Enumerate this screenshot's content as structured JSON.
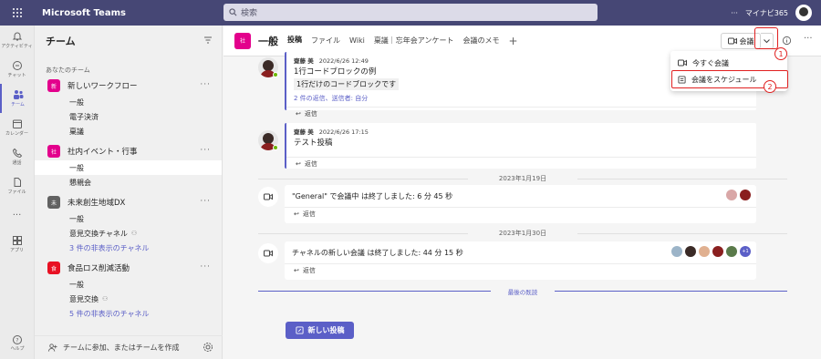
{
  "topbar": {
    "app_title": "Microsoft Teams",
    "search_placeholder": "検索",
    "more": "···",
    "user_name": "マイナビ365"
  },
  "rail": [
    {
      "label": "アクティビティ",
      "icon": "bell-icon"
    },
    {
      "label": "チャット",
      "icon": "chat-icon"
    },
    {
      "label": "チーム",
      "icon": "teams-icon",
      "active": true
    },
    {
      "label": "カレンダー",
      "icon": "calendar-icon"
    },
    {
      "label": "通話",
      "icon": "phone-icon"
    },
    {
      "label": "ファイル",
      "icon": "file-icon"
    },
    {
      "label": "···",
      "icon": "more-icon"
    },
    {
      "label": "アプリ",
      "icon": "apps-icon"
    }
  ],
  "rail_help": "ヘルプ",
  "sidebar": {
    "title": "チーム",
    "section": "あなたのチーム",
    "teams": [
      {
        "name": "新しいワークフロー",
        "initial": "新",
        "color": "#e3008c",
        "channels": [
          "一般",
          "電子決済",
          "稟議"
        ]
      },
      {
        "name": "社内イベント・行事",
        "initial": "社",
        "color": "#e3008c",
        "channels": [
          "一般",
          "懇親会"
        ]
      },
      {
        "name": "未来創生地域DX",
        "initial": "未",
        "color": "#616161",
        "channels": [
          "一般",
          "意見交換チャネル",
          "3 件の非表示のチャネル"
        ]
      },
      {
        "name": "食品ロス削減活動",
        "initial": "食",
        "color": "#e81123",
        "channels": [
          "一般",
          "意見交換",
          "5 件の非表示のチャネル"
        ]
      }
    ],
    "footer": "チームに参加、またはチームを作成"
  },
  "channel_header": {
    "initial": "社",
    "name": "一般",
    "tabs": [
      "投稿",
      "ファイル",
      "Wiki",
      "稟議｜忘年会アンケート",
      "会議のメモ"
    ],
    "add_tab": "+",
    "meet_label": "会議",
    "more": "···"
  },
  "dropdown": {
    "items": [
      "今すぐ会議",
      "会議をスケジュール"
    ]
  },
  "callouts": [
    "1",
    "2"
  ],
  "messages": [
    {
      "author": "齋藤 美",
      "time": "2022/6/26 12:49",
      "line1": "1行コードブロックの例",
      "code": "1行だけのコードブロックです",
      "replies": "2 件の返信、送信者: 自分",
      "reply_label": "返信"
    },
    {
      "author": "齋藤 美",
      "time": "2022/6/26 17:15",
      "line1": "テスト投稿",
      "reply_label": "返信"
    }
  ],
  "dates": [
    "2023年1月19日",
    "2023年1月30日"
  ],
  "meetings": [
    {
      "text": "\"General\" で会議中 は終了しました: 6 分 45 秒",
      "reply_label": "返信"
    },
    {
      "text": "チャネルの新しい会議 は終了しました: 44 分 15 秒",
      "reply_label": "返信",
      "extra": "+1"
    }
  ],
  "last_read": "最後の既読",
  "new_post": "新しい投稿"
}
